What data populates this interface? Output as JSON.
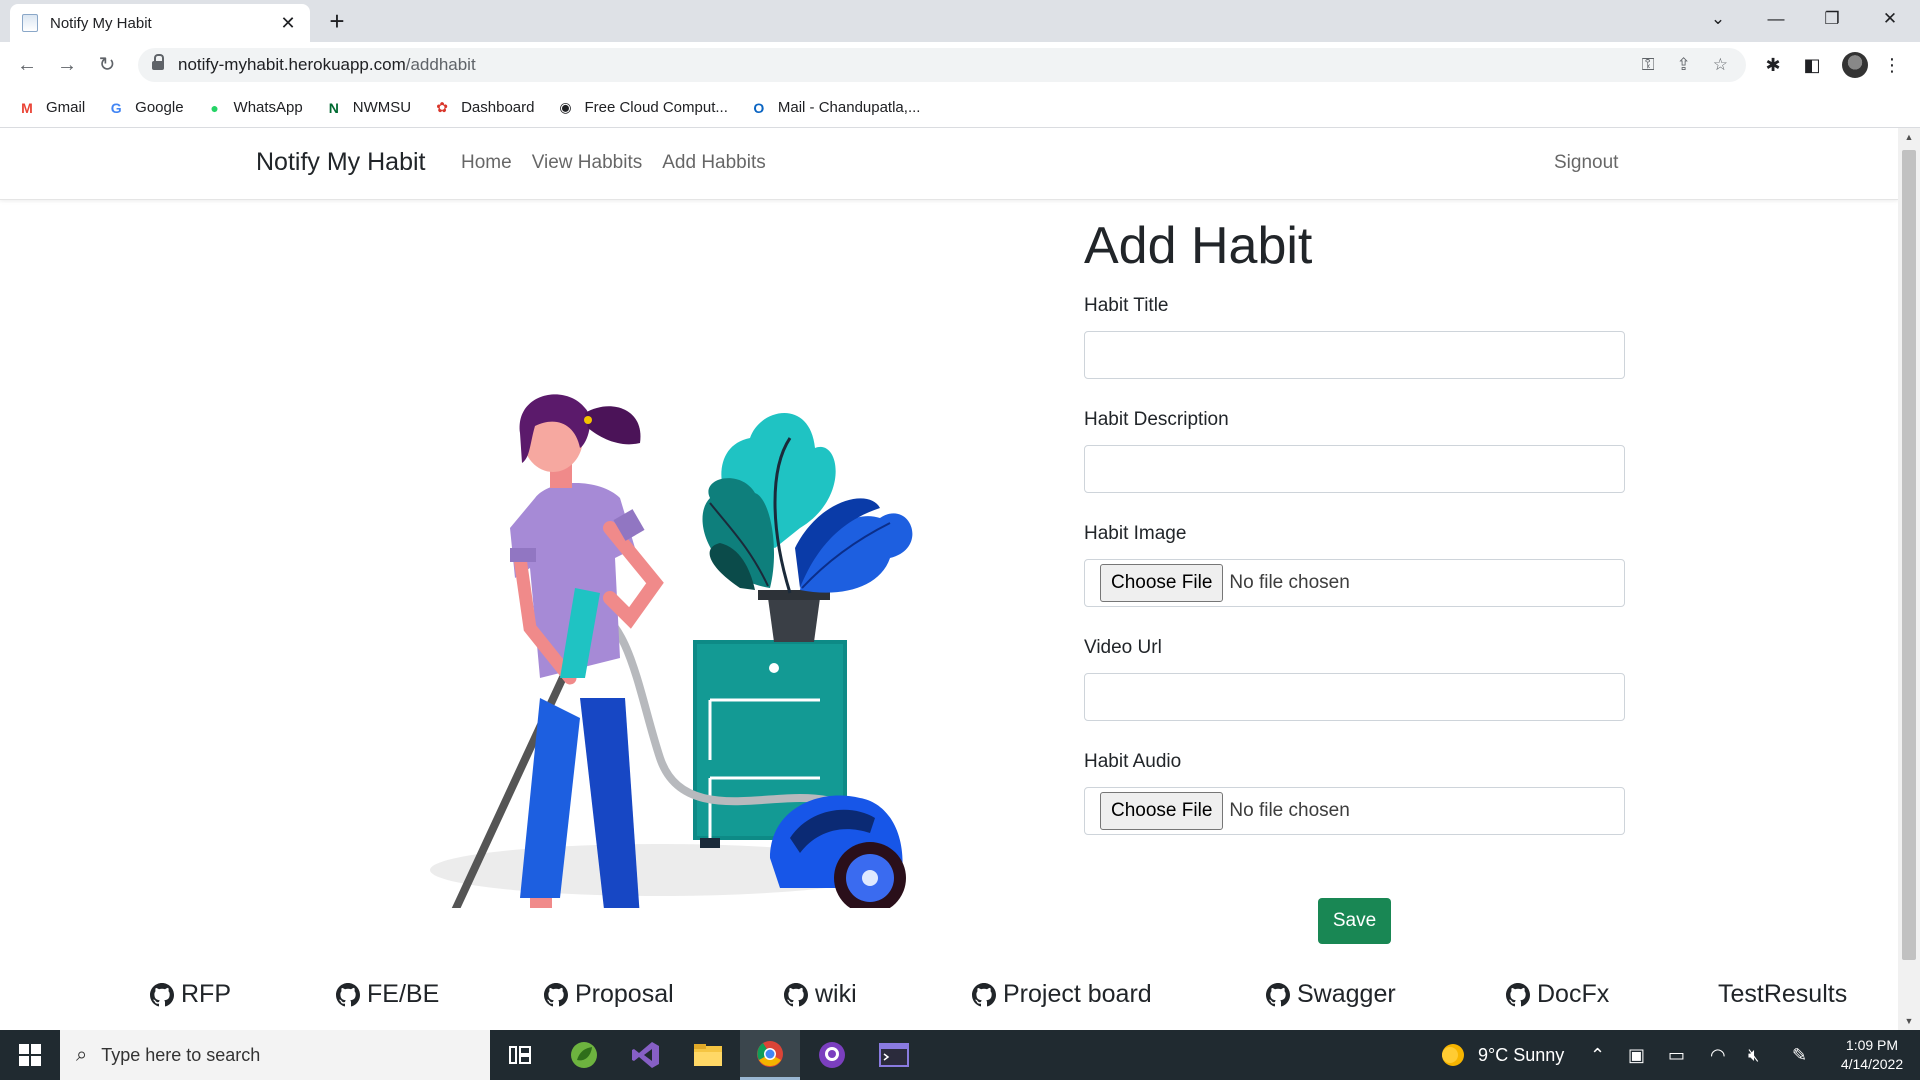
{
  "browser": {
    "tab_title": "Notify My Habit",
    "tab_close": "✕",
    "new_tab": "+",
    "url_host": "notify-myhabit.herokuapp.com",
    "url_path": "/addhabit",
    "bookmarks": [
      {
        "label": "Gmail",
        "icon": "gmail-icon",
        "glyph": "M",
        "color": "#ea4335"
      },
      {
        "label": "Google",
        "icon": "google-icon",
        "glyph": "G",
        "color": "#4285f4"
      },
      {
        "label": "WhatsApp",
        "icon": "whatsapp-icon",
        "glyph": "●",
        "color": "#25d366"
      },
      {
        "label": "NWMSU",
        "icon": "nwmsu-icon",
        "glyph": "N",
        "color": "#006a31"
      },
      {
        "label": "Dashboard",
        "icon": "dashboard-icon",
        "glyph": "✿",
        "color": "#d9362b"
      },
      {
        "label": "Free Cloud Comput...",
        "icon": "cloud-icon",
        "glyph": "◉",
        "color": "#202124"
      },
      {
        "label": "Mail - Chandupatla,...",
        "icon": "outlook-icon",
        "glyph": "O",
        "color": "#0a64c2"
      }
    ]
  },
  "navbar": {
    "brand": "Notify My Habit",
    "links": [
      "Home",
      "View Habbits",
      "Add Habbits"
    ],
    "signout": "Signout"
  },
  "form": {
    "heading": "Add Habit",
    "fields": [
      {
        "label": "Habit Title",
        "type": "text",
        "value": ""
      },
      {
        "label": "Habit Description",
        "type": "text",
        "value": ""
      },
      {
        "label": "Habit Image",
        "type": "file",
        "button": "Choose File",
        "status": "No file chosen"
      },
      {
        "label": "Video Url",
        "type": "text",
        "value": ""
      },
      {
        "label": "Habit Audio",
        "type": "file",
        "button": "Choose File",
        "status": "No file chosen"
      }
    ],
    "save_label": "Save"
  },
  "footer_links": [
    "RFP",
    "FE/BE",
    "Proposal",
    "wiki",
    "Project board",
    "Swagger",
    "DocFx",
    "TestResults"
  ],
  "taskbar": {
    "search_placeholder": "Type here to search",
    "weather": "9°C  Sunny",
    "time": "1:09 PM",
    "date": "4/14/2022"
  }
}
